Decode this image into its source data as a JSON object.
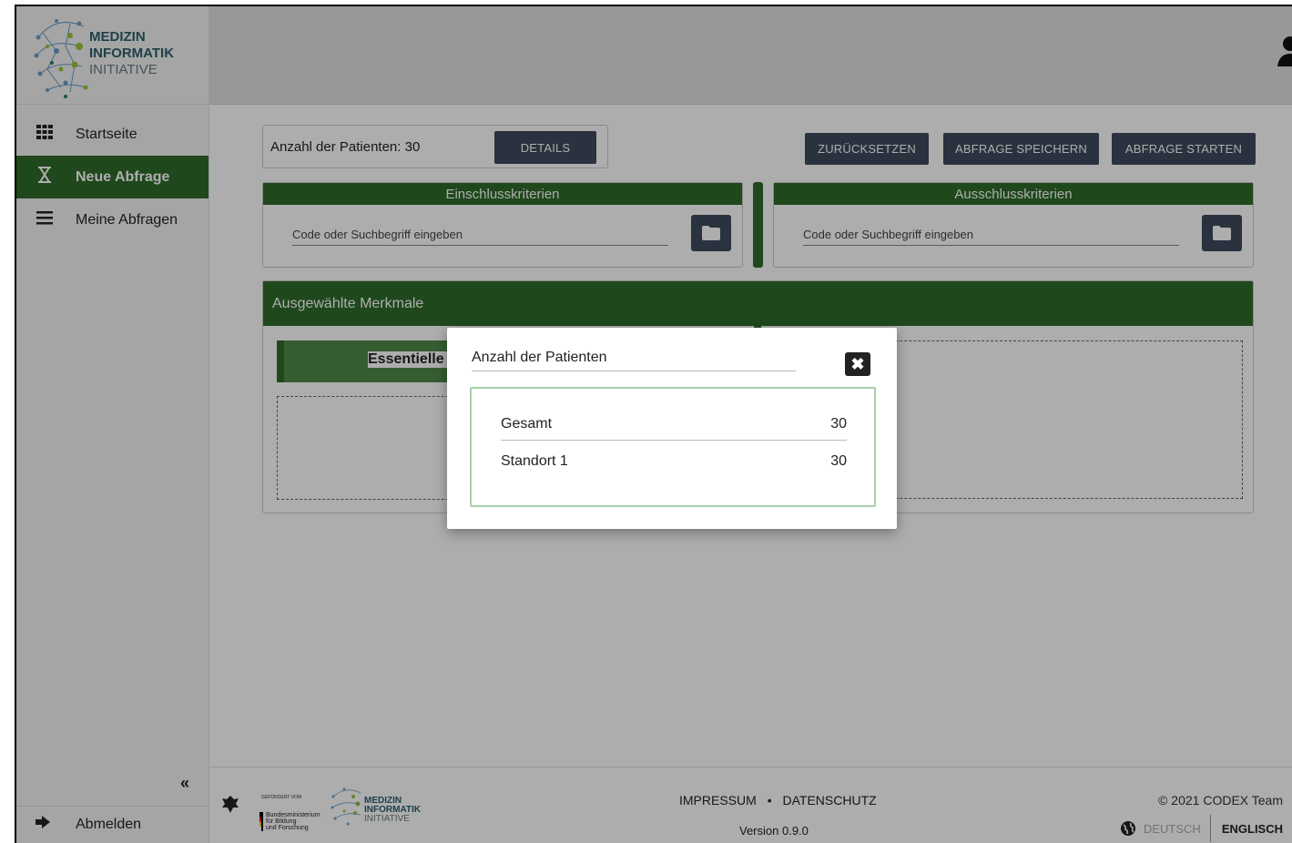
{
  "logo": {
    "line1": "MEDIZIN",
    "line2": "INFORMATIK",
    "line3": "INITIATIVE"
  },
  "sidebar": {
    "items": [
      {
        "label": "Startseite",
        "icon": "grid-icon"
      },
      {
        "label": "Neue Abfrage",
        "icon": "hourglass-icon",
        "active": true
      },
      {
        "label": "Meine Abfragen",
        "icon": "list-icon"
      }
    ],
    "collapse_label": "«",
    "logout_label": "Abmelden"
  },
  "toolbar": {
    "count_label": "Anzahl der Patienten: 30",
    "details_label": "DETAILS",
    "reset_label": "ZURÜCKSETZEN",
    "save_label": "ABFRAGE SPEICHERN",
    "start_label": "ABFRAGE STARTEN"
  },
  "inclusion": {
    "title": "Einschlusskriterien",
    "placeholder": "Code oder Suchbegriff eingeben"
  },
  "exclusion": {
    "title": "Ausschlusskriterien",
    "placeholder": "Code oder Suchbegriff eingeben"
  },
  "selected": {
    "title": "Ausgewählte Merkmale",
    "item_label": "Essentielle (p"
  },
  "modal": {
    "title": "Anzahl der Patienten",
    "rows": [
      {
        "label": "Gesamt",
        "value": "30"
      },
      {
        "label": "Standort 1",
        "value": "30"
      }
    ]
  },
  "footer": {
    "impressum": "IMPRESSUM",
    "separator": "•",
    "datenschutz": "DATENSCHUTZ",
    "version": "Version 0.9.0",
    "copyright": "© 2021 CODEX Team",
    "lang_de": "DEUTSCH",
    "lang_en": "ENGLISCH",
    "sponsor_top": "GEFÖRDERT VOM",
    "sponsor_l1": "Bundesministerium",
    "sponsor_l2": "für Bildung",
    "sponsor_l3": "und Forschung"
  },
  "colors": {
    "primary_green": "#2e6b2a",
    "dark_button": "#3d4b5c",
    "modal_border": "#a8d0a8"
  }
}
